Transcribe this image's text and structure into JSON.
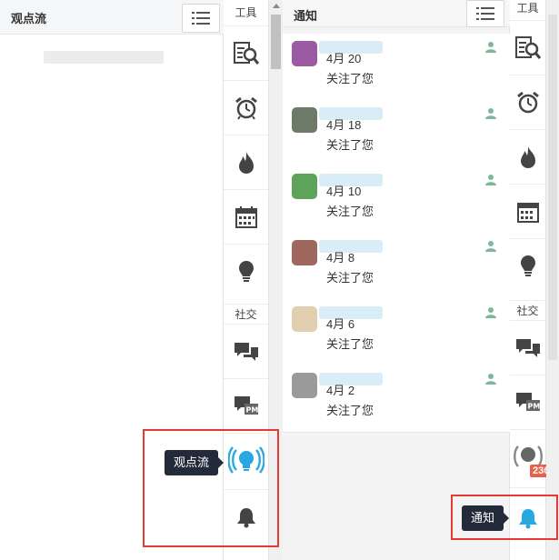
{
  "left_panel": {
    "title": "观点流",
    "list_icon": "list-icon"
  },
  "left_toolbar": {
    "tools_label": "工具",
    "social_label": "社交",
    "tools": [
      "search-document-icon",
      "alarm-clock-icon",
      "flame-icon",
      "calendar-icon",
      "lightbulb-icon"
    ],
    "social": [
      "chat-bubbles-icon",
      "private-message-icon",
      "broadcast-lightbulb-icon",
      "bell-icon"
    ],
    "tooltip": "观点流"
  },
  "notifications": {
    "title": "通知",
    "items": [
      {
        "date": "4月 20",
        "text": "关注了您",
        "avatar_color": "#9b5aa3"
      },
      {
        "date": "4月 18",
        "text": "关注了您",
        "avatar_color": "#6d7a67"
      },
      {
        "date": "4月 10",
        "text": "关注了您",
        "avatar_color": "#5ea35a"
      },
      {
        "date": "4月 8",
        "text": "关注了您",
        "avatar_color": "#a0675f"
      },
      {
        "date": "4月 6",
        "text": "关注了您",
        "avatar_color": "#e2cfb0"
      },
      {
        "date": "4月 2",
        "text": "关注了您",
        "avatar_color": "#9a9a9a"
      }
    ]
  },
  "right_toolbar": {
    "tools_label": "工具",
    "social_label": "社交",
    "badge": "236",
    "tooltip": "通知"
  },
  "colors": {
    "accent_blue": "#29a7e1",
    "follow_green": "#7cb89a",
    "tooltip_bg": "#232a3a",
    "highlight_red": "#e53935",
    "badge_red": "#e8604c"
  }
}
